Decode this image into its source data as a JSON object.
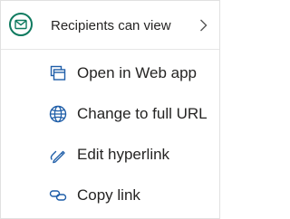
{
  "header": {
    "icon": "envelope-icon",
    "label": "Recipients can view",
    "chevron": "chevron-right-icon"
  },
  "items": [
    {
      "icon": "open-web-app-icon",
      "label": "Open in Web app"
    },
    {
      "icon": "globe-icon",
      "label": "Change to full URL"
    },
    {
      "icon": "edit-link-icon",
      "label": "Edit hyperlink"
    },
    {
      "icon": "copy-link-icon",
      "label": "Copy link"
    }
  ],
  "colors": {
    "accent": "#0e7a5f",
    "icon_blue": "#1f5ea8",
    "text": "#252423"
  }
}
